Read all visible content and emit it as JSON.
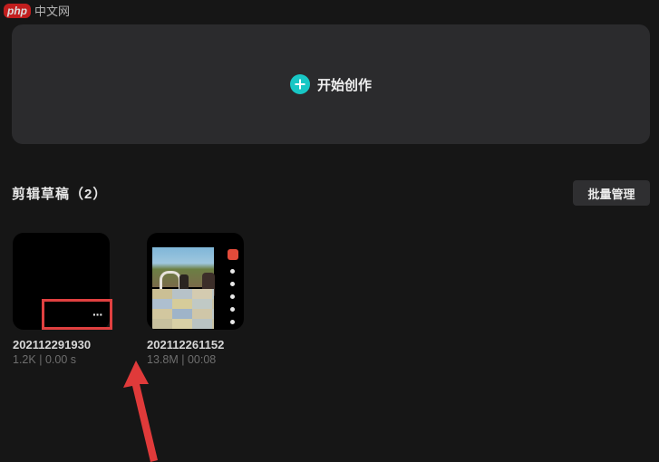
{
  "watermark": {
    "logo": "php",
    "site": "中文网"
  },
  "start": {
    "label": "开始创作",
    "icon": "plus-circle-icon",
    "accent_color": "#18c7c5"
  },
  "drafts_section": {
    "title": "剪辑草稿（2）",
    "batch_button_label": "批量管理"
  },
  "drafts": [
    {
      "name": "202112291930",
      "size": "1.2K",
      "separator": "|",
      "duration": "0.00 s",
      "more_label": "···"
    },
    {
      "name": "202112261152",
      "size": "13.8M",
      "separator": "|",
      "duration": "00:08"
    }
  ],
  "annotation": {
    "highlight_color": "#e04040"
  }
}
